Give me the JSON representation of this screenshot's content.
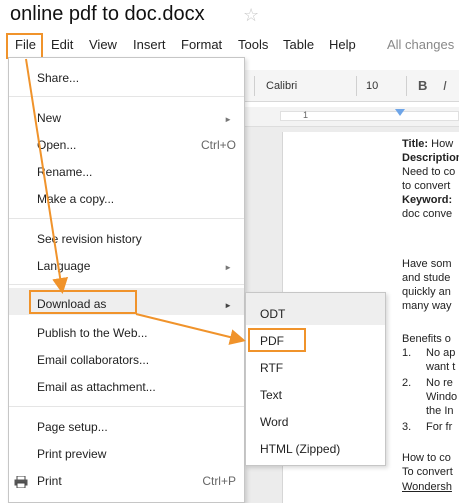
{
  "document": {
    "title": "online pdf to doc.docx",
    "star_icon": "star-icon",
    "saved_status": "All changes"
  },
  "menubar": {
    "items": [
      "File",
      "Edit",
      "View",
      "Insert",
      "Format",
      "Tools",
      "Table",
      "Help"
    ]
  },
  "toolbar": {
    "font": "Calibri",
    "size": "10",
    "bold": "B",
    "italic": "I"
  },
  "ruler": {
    "number": "1"
  },
  "file_menu": {
    "share": "Share...",
    "new": "New",
    "open": "Open...",
    "open_shortcut": "Ctrl+O",
    "rename": "Rename...",
    "copy": "Make a copy...",
    "revision": "See revision history",
    "language": "Language",
    "download": "Download as",
    "publish": "Publish to the Web...",
    "email_collab": "Email collaborators...",
    "email_attach": "Email as attachment...",
    "page_setup": "Page setup...",
    "print_preview": "Print preview",
    "print": "Print",
    "print_shortcut": "Ctrl+P"
  },
  "download_submenu": {
    "items": [
      "ODT",
      "PDF",
      "RTF",
      "Text",
      "Word",
      "HTML (Zipped)"
    ]
  },
  "doc_content": {
    "title_label": "Title:",
    "title_value": " How",
    "description_label": "Description",
    "line_need": "Need to co",
    "line_convert": "to convert",
    "keyword_label": "Keyword:",
    "line_docconv": "doc conve",
    "line_have": "Have som",
    "line_stude": "and stude",
    "line_quickly": "quickly an",
    "line_many": "many way",
    "line_benefits": "Benefits o",
    "list1_num": "1.",
    "list1_a": "No ap",
    "list1_b": "want t",
    "list2_num": "2.",
    "list2_a": "No re",
    "list2_b": "Windo",
    "list2_c": "the In",
    "list3_num": "3.",
    "list3_a": "For fr",
    "line_howto": "How to co",
    "line_toconvert": "To convert",
    "line_wondershare": "Wondersh"
  },
  "colors": {
    "highlight_border": "#f0932b",
    "menu_hover": "#eeeeee"
  }
}
